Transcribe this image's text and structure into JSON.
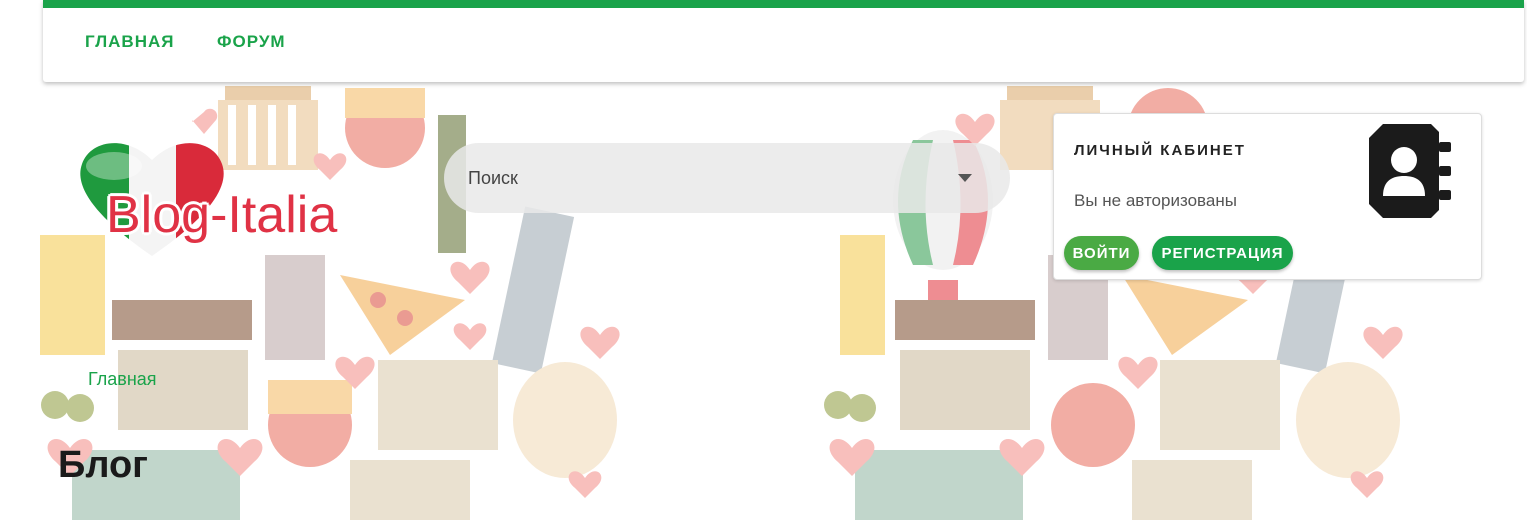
{
  "nav": {
    "items": [
      {
        "label": "ГЛАВНАЯ"
      },
      {
        "label": "ФОРУМ"
      }
    ]
  },
  "logo": {
    "text": "Blog-Italia"
  },
  "search": {
    "placeholder": "Поиск"
  },
  "account": {
    "title": "ЛИЧНЫЙ КАБИНЕТ",
    "status": "Вы не авторизованы",
    "login_label": "ВОЙТИ",
    "register_label": "РЕГИСТРАЦИЯ"
  },
  "breadcrumb": {
    "home": "Главная"
  },
  "page": {
    "title": "Блог"
  },
  "colors": {
    "accent": "#1aa34a",
    "logo_red": "#e03245",
    "heart": "#f28b86"
  }
}
